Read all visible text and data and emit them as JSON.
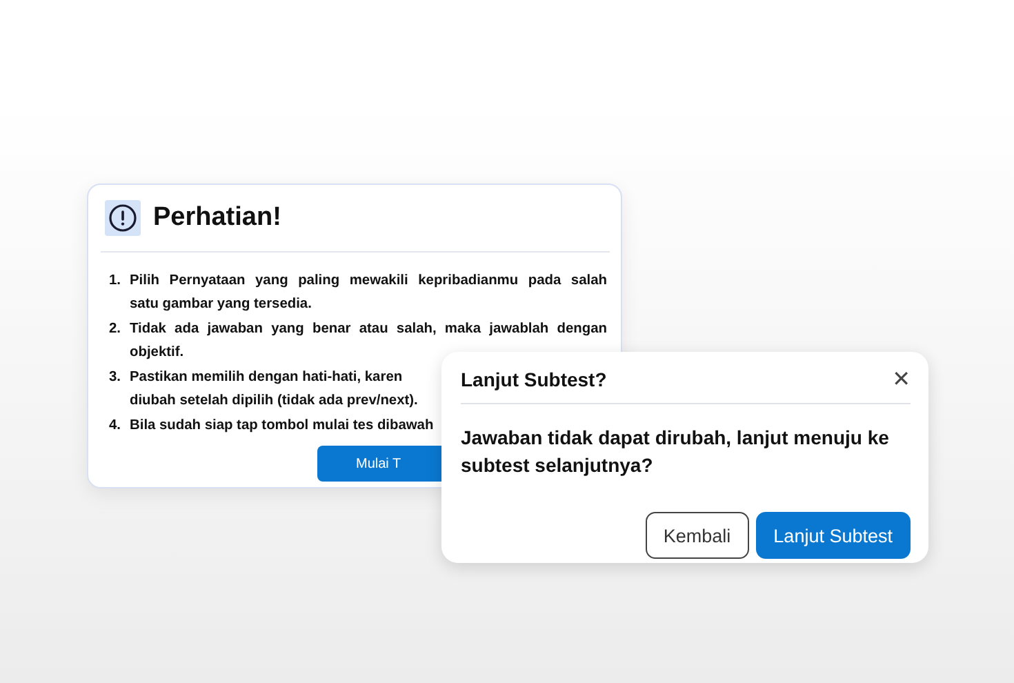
{
  "notice": {
    "title": "Perhatian!",
    "items": [
      {
        "number": "1.",
        "lines": [
          "Pilih Pernyataan yang paling mewakili kepribadianmu pada salah",
          "satu gambar yang tersedia."
        ]
      },
      {
        "number": "2.",
        "lines": [
          "Tidak ada jawaban yang benar atau salah, maka jawablah dengan",
          "objektif."
        ]
      },
      {
        "number": "3.",
        "lines": [
          "Pastikan memilih dengan hati-hati, karen",
          "diubah setelah dipilih (tidak ada prev/next)."
        ]
      },
      {
        "number": "4.",
        "lines": [
          "Bila sudah siap tap tombol mulai tes dibawah"
        ]
      }
    ],
    "button": "Mulai T"
  },
  "dialog": {
    "title": "Lanjut Subtest?",
    "close": "✕",
    "message": "Jawaban tidak dapat dirubah, lanjut menuju ke subtest selanjutnya?",
    "buttons": [
      {
        "label": "Kembali",
        "kind": "secondary"
      },
      {
        "label": "Lanjut Subtest",
        "kind": "primary"
      }
    ]
  }
}
